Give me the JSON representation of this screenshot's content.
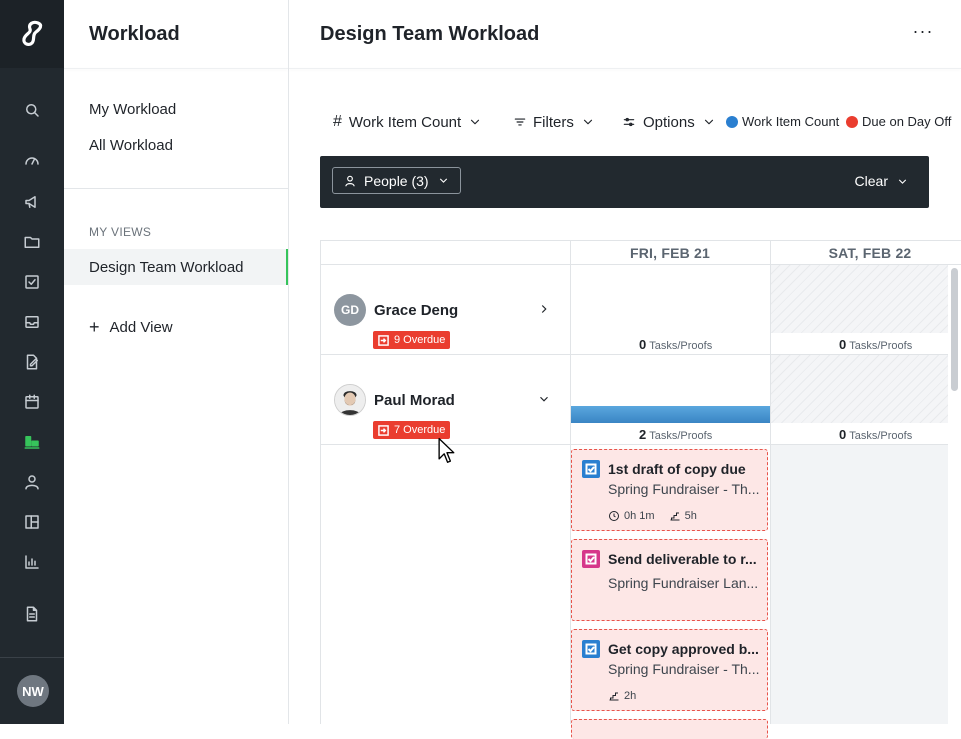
{
  "app": {
    "user_initials": "NW",
    "accent_color": "#36c45b",
    "rail_icons": [
      "search-icon",
      "dashboard-icon",
      "megaphone-icon",
      "folder-icon",
      "task-icon",
      "inbox-icon",
      "proof-icon",
      "calendar-icon",
      "workload-icon",
      "person-icon",
      "layout-icon",
      "reports-icon",
      "document-icon"
    ]
  },
  "sidebar": {
    "title": "Workload",
    "links": [
      "My Workload",
      "All Workload"
    ],
    "section_label": "MY VIEWS",
    "active_view": "Design Team Workload",
    "add_view": "Add View"
  },
  "main": {
    "title": "Design Team Workload",
    "more": "···",
    "toolbar": {
      "metric_icon": "#",
      "metric": "Work Item Count",
      "filters": "Filters",
      "options": "Options"
    },
    "legend": [
      {
        "label": "Work Item Count",
        "color": "#2a7fd0"
      },
      {
        "label": "Due on Day Off",
        "color": "#ea3d2f"
      }
    ],
    "filter_bar": {
      "people_chip": "People (3)",
      "clear": "Clear"
    },
    "days": [
      "FRI, FEB 21",
      "SAT, FEB 22"
    ],
    "people": [
      {
        "initials": "GD",
        "name": "Grace Deng",
        "overdue": "9 Overdue",
        "counts": [
          {
            "value": "0",
            "unit": "Tasks/Proofs"
          },
          {
            "value": "0",
            "unit": "Tasks/Proofs"
          }
        ]
      },
      {
        "name": "Paul Morad",
        "overdue": "7 Overdue",
        "counts": [
          {
            "value": "2",
            "unit": "Tasks/Proofs",
            "load": 0.3
          },
          {
            "value": "0",
            "unit": "Tasks/Proofs"
          }
        ]
      }
    ],
    "tasks": [
      {
        "title": "1st draft of copy due",
        "subtitle": "Spring Fundraiser - Th...",
        "type": "task",
        "color": "#2a7fd0",
        "meta": [
          "0h 1m",
          "5h"
        ]
      },
      {
        "title": "Send deliverable to r...",
        "subtitle": "Spring Fundraiser Lan...",
        "type": "proof",
        "color": "#d6378a",
        "meta": []
      },
      {
        "title": "Get copy approved b...",
        "subtitle": "Spring Fundraiser - Th...",
        "type": "task",
        "color": "#2a7fd0",
        "meta": [
          "2h"
        ]
      }
    ]
  }
}
